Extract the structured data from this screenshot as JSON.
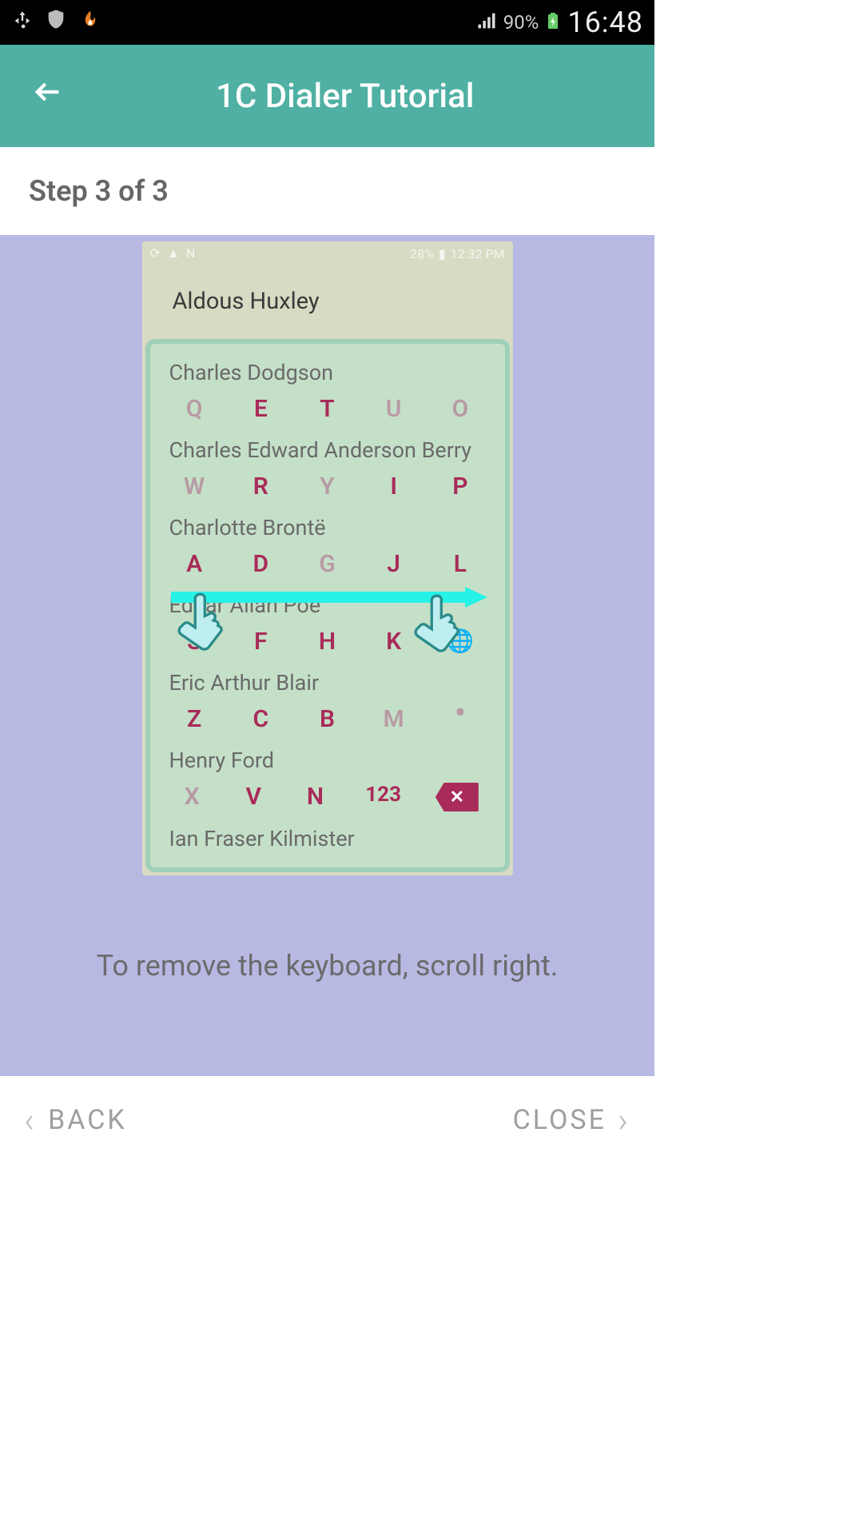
{
  "device_status": {
    "battery_pct": "90%",
    "clock": "16:48"
  },
  "header": {
    "title": "1C Dialer Tutorial"
  },
  "step": {
    "label": "Step 3 of 3"
  },
  "phone_mock": {
    "status": {
      "battery_pct": "28%",
      "time": "12:32 PM"
    },
    "top_contact": "Aldous Huxley",
    "contacts": [
      "Charles Dodgson",
      "Charles Edward Anderson Berry",
      "Charlotte Brontë",
      "Edgar Allan Poe",
      "Eric Arthur Blair",
      "Henry Ford",
      "Ian Fraser Kilmister"
    ],
    "key_rows": {
      "r0": {
        "k0": "Q",
        "k1": "E",
        "k2": "T",
        "k3": "U",
        "k4": "O"
      },
      "r1": {
        "k0": "W",
        "k1": "R",
        "k2": "Y",
        "k3": "I",
        "k4": "P"
      },
      "r2": {
        "k0": "A",
        "k1": "D",
        "k2": "G",
        "k3": "J",
        "k4": "L"
      },
      "r3": {
        "k0": "S",
        "k1": "F",
        "k2": "H",
        "k3": "K",
        "k4": "🌐"
      },
      "r4": {
        "k0": "Z",
        "k1": "C",
        "k2": "B",
        "k3": "M",
        "k4": "•"
      },
      "r5": {
        "k0": "X",
        "k1": "V",
        "k2": "N",
        "k3": "123",
        "k4": "✕"
      }
    }
  },
  "instruction": "To remove the keyboard, scroll right.",
  "footer": {
    "back_label": "BACK",
    "close_label": "CLOSE"
  },
  "colors": {
    "header_bg": "#4fb0a3",
    "body_bg": "#b8b9e3",
    "key_accent": "#a92b5a",
    "swipe_accent": "#26f2e8"
  }
}
